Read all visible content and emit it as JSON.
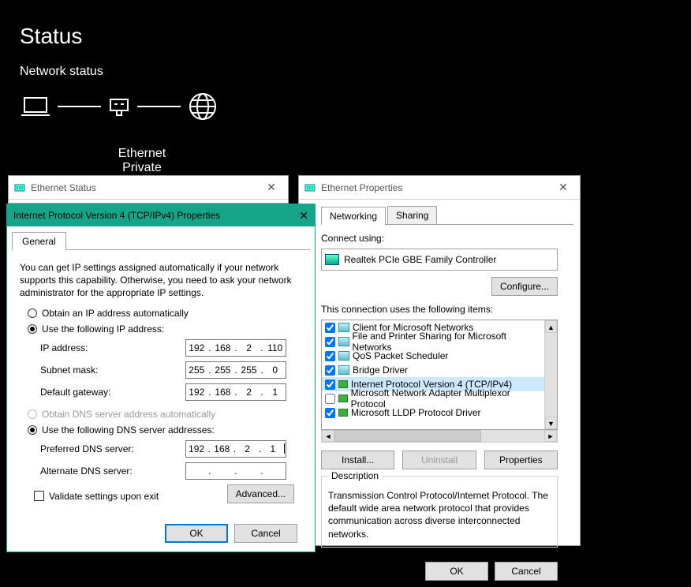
{
  "page": {
    "title": "Status",
    "section": "Network status"
  },
  "diagram": {
    "ethernet_label": "Ethernet",
    "network_type": "Private network"
  },
  "ethStatus": {
    "title": "Ethernet Status"
  },
  "ethProps": {
    "title": "Ethernet Properties",
    "tabs": {
      "networking": "Networking",
      "sharing": "Sharing"
    },
    "connect_label": "Connect using:",
    "nic_name": "Realtek PCIe GBE Family Controller",
    "configure": "Configure...",
    "items_label": "This connection uses the following items:",
    "items": [
      {
        "checked": true,
        "label": "Client for Microsoft Networks"
      },
      {
        "checked": true,
        "label": "File and Printer Sharing for Microsoft Networks"
      },
      {
        "checked": true,
        "label": "QoS Packet Scheduler"
      },
      {
        "checked": true,
        "label": "Bridge Driver"
      },
      {
        "checked": true,
        "label": "Internet Protocol Version 4 (TCP/IPv4)",
        "selected": true
      },
      {
        "checked": false,
        "label": "Microsoft Network Adapter Multiplexor Protocol"
      },
      {
        "checked": true,
        "label": "Microsoft LLDP Protocol Driver"
      }
    ],
    "install": "Install...",
    "uninstall": "Uninstall",
    "properties": "Properties",
    "desc_title": "Description",
    "desc_text": "Transmission Control Protocol/Internet Protocol. The default wide area network protocol that provides communication across diverse interconnected networks.",
    "ok": "OK",
    "cancel": "Cancel"
  },
  "ipv4": {
    "title": "Internet Protocol Version 4 (TCP/IPv4) Properties",
    "tab": "General",
    "intro": "You can get IP settings assigned automatically if your network supports this capability. Otherwise, you need to ask your network administrator for the appropriate IP settings.",
    "radio_auto_ip": "Obtain an IP address automatically",
    "radio_use_ip": "Use the following IP address:",
    "ip_label": "IP address:",
    "ip_value": {
      "a": "192",
      "b": "168",
      "c": "2",
      "d": "110"
    },
    "mask_label": "Subnet mask:",
    "mask_value": {
      "a": "255",
      "b": "255",
      "c": "255",
      "d": "0"
    },
    "gw_label": "Default gateway:",
    "gw_value": {
      "a": "192",
      "b": "168",
      "c": "2",
      "d": "1"
    },
    "radio_auto_dns": "Obtain DNS server address automatically",
    "radio_use_dns": "Use the following DNS server addresses:",
    "pdns_label": "Preferred DNS server:",
    "pdns_value": {
      "a": "192",
      "b": "168",
      "c": "2",
      "d": "1"
    },
    "adns_label": "Alternate DNS server:",
    "validate": "Validate settings upon exit",
    "advanced": "Advanced...",
    "ok": "OK",
    "cancel": "Cancel"
  }
}
